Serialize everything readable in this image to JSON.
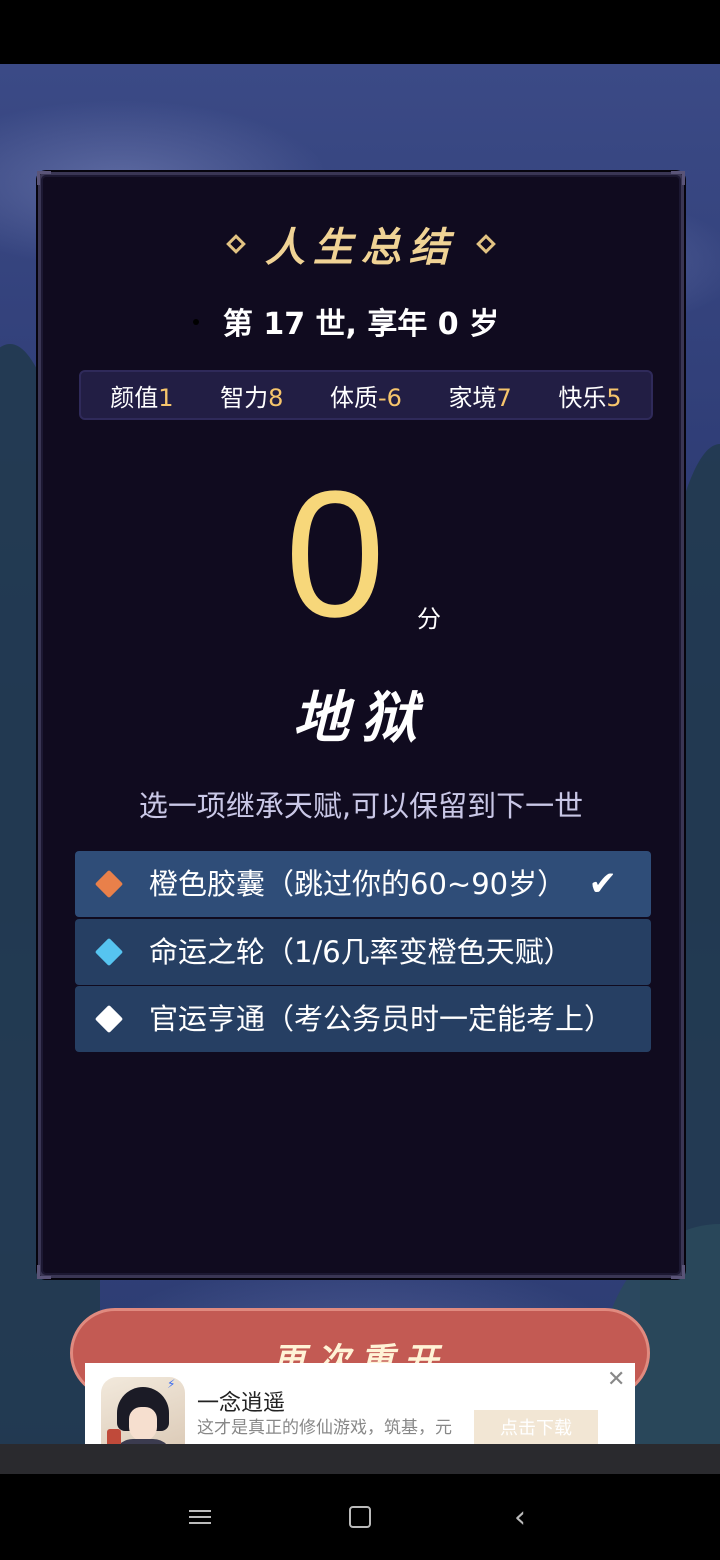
{
  "panel": {
    "title": "人生总结",
    "subtitle": "第 17 世, 享年 0 岁",
    "stats": [
      {
        "label": "颜值",
        "value": "1"
      },
      {
        "label": "智力",
        "value": "8"
      },
      {
        "label": "体质",
        "value": "-6"
      },
      {
        "label": "家境",
        "value": "7"
      },
      {
        "label": "快乐",
        "value": "5"
      }
    ],
    "score": "0",
    "score_unit": "分",
    "grade": "地狱",
    "inherit_hint": "选一项继承天赋,可以保留到下一世",
    "talents": [
      {
        "text": "橙色胶囊（跳过你的60~90岁）",
        "icon": "orange-diamond-icon",
        "color": "#e9804a",
        "selected": true
      },
      {
        "text": "命运之轮（1/6几率变橙色天赋）",
        "icon": "blue-diamond-icon",
        "color": "#56c4f0",
        "selected": false
      },
      {
        "text": "官运亨通（考公务员时一定能考上）",
        "icon": "white-diamond-icon",
        "color": "#ffffff",
        "selected": false
      }
    ],
    "check_mark": "✔"
  },
  "restart_button": "再次重开",
  "ad": {
    "app_name": "一念逍遥",
    "description": "这才是真正的修仙游戏，筑基，元婴，化神，渡劫飞升",
    "download_label": "点击下载",
    "close": "✕",
    "tag": "广告"
  },
  "nav": {
    "back": "‹"
  },
  "colors": {
    "score": "#f7d77a",
    "stat_value": "#f6c56c",
    "title": "#f0d395",
    "restart": "#c35a53"
  }
}
